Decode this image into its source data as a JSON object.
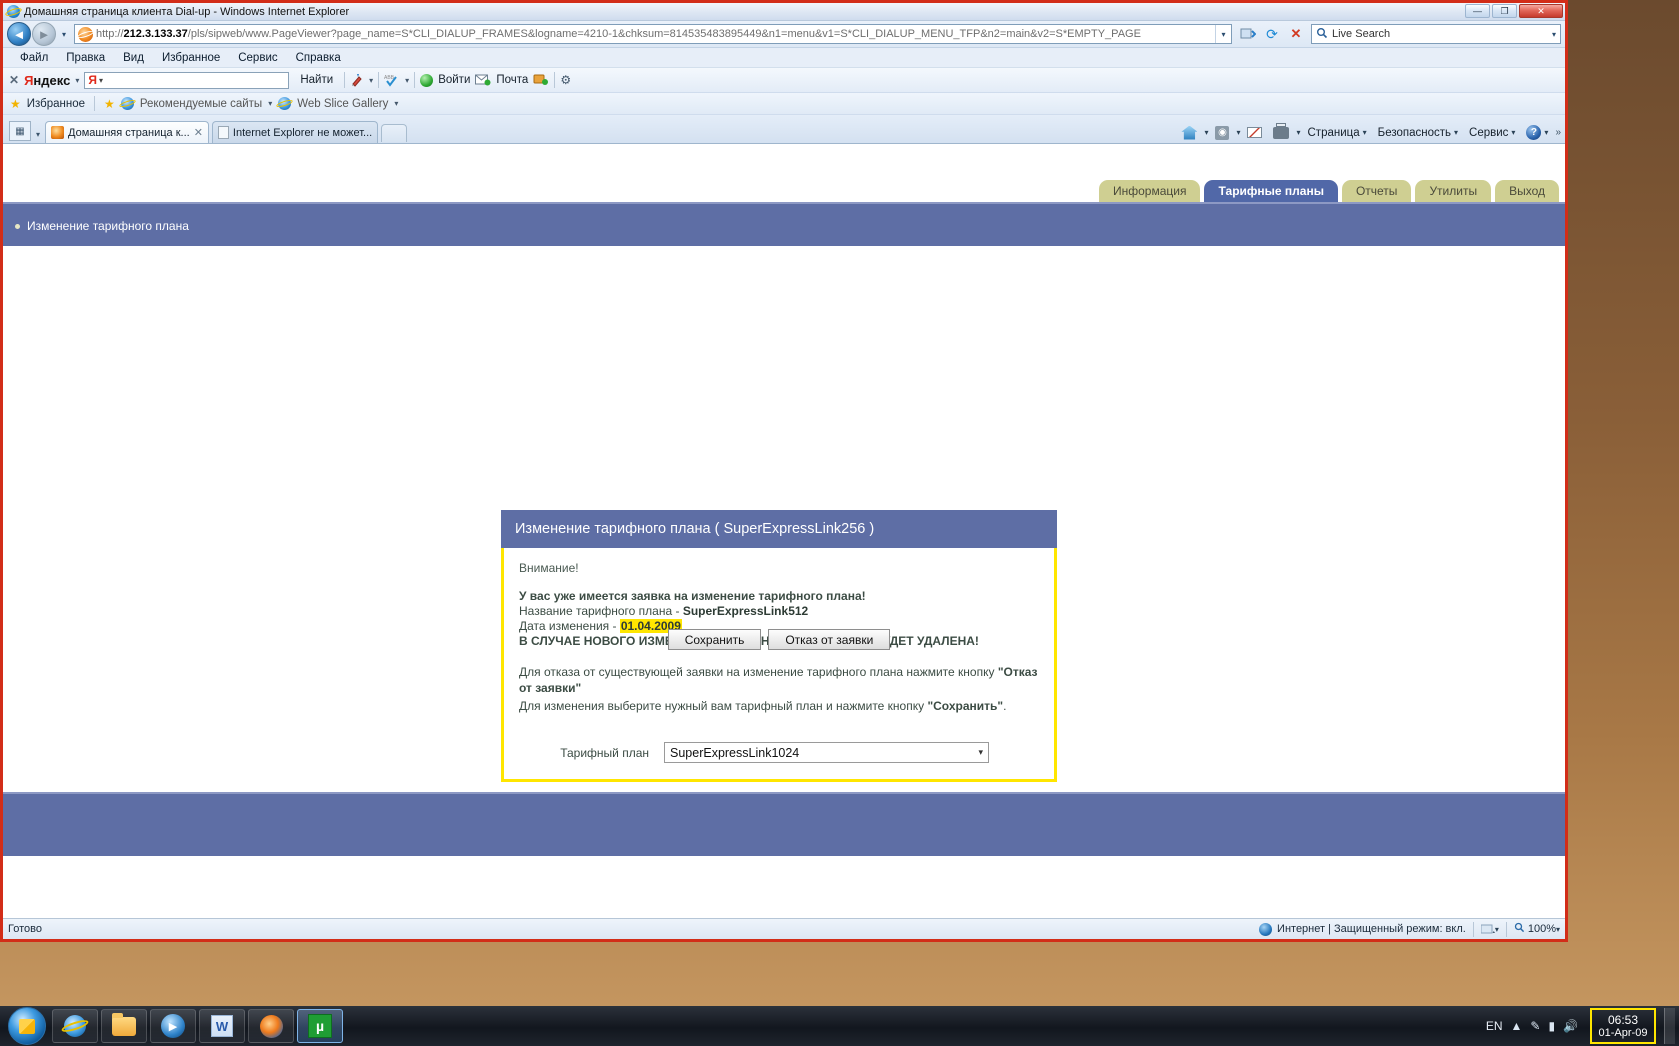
{
  "window": {
    "title": "Домашняя страница клиента Dial-up - Windows Internet Explorer",
    "icon": "ie-logo-icon",
    "minimize": "—",
    "maximize": "❐",
    "close": "✕"
  },
  "address_bar": {
    "back_icon": "◄",
    "forward_icon": "►",
    "history_caret": "▾",
    "url_prefix": "http://",
    "url_host": "212.3.133.37",
    "url_path": "/pls/sipweb/www.PageViewer?page_name=S*CLI_DIALUP_FRAMES&logname=4210-1&chksum=814535483895449&n1=menu&v1=S*CLI_DIALUP_MENU_TFP&n2=main&v2=S*EMPTY_PAGE",
    "dropdown_caret": "▾",
    "refresh_icon": "⟳",
    "stop_icon": "✕",
    "search_placeholder": "Live Search",
    "search_icon": "🔍",
    "search_caret": "▾"
  },
  "menubar": {
    "items": [
      "Файл",
      "Правка",
      "Вид",
      "Избранное",
      "Сервис",
      "Справка"
    ]
  },
  "yandex_bar": {
    "close_icon": "✕",
    "logo_first": "Я",
    "logo_rest": "ндекс",
    "logo_caret": "▾",
    "input_prefix": "Я",
    "input_value": "",
    "find_label": "Найти",
    "translate_caret": "▾",
    "spell_caret": "▾",
    "login_label": "Войти",
    "mail_label": "Почта",
    "gear_icon": "⚙"
  },
  "favorites_bar": {
    "star_icon": "★",
    "favorites_label": "Избранное",
    "suggested_label": "Рекомендуемые сайты",
    "suggested_caret": "▾",
    "webslice_label": "Web Slice Gallery",
    "webslice_caret": "▾"
  },
  "browser_tabs": {
    "quicktabs_icon": "▦",
    "quicktabs_caret": "▾",
    "items": [
      {
        "label": "Домашняя страница к...",
        "close": "✕",
        "active": true
      },
      {
        "label": "Internet Explorer не может...",
        "close": "",
        "active": false
      }
    ]
  },
  "command_bar": {
    "home_caret": "▾",
    "feeds_caret": "▾",
    "print_caret": "▾",
    "page_label": "Страница",
    "security_label": "Безопасность",
    "service_label": "Сервис",
    "help_caret": "▾",
    "overflow_icon": "»"
  },
  "page": {
    "nav_tabs": [
      {
        "label": "Информация",
        "active": false
      },
      {
        "label": "Тарифные планы",
        "active": true
      },
      {
        "label": "Отчеты",
        "active": false
      },
      {
        "label": "Утилиты",
        "active": false
      },
      {
        "label": "Выход",
        "active": false
      }
    ],
    "breadcrumb": "Изменение тарифного плана",
    "card": {
      "header": "Изменение тарифного плана ( SuperExpressLink256 )",
      "attention": "Внимание!",
      "warning_title": "У вас уже имеется заявка на изменение тарифного плана!",
      "plan_name_label": "Название тарифного плана - ",
      "plan_name_value": "SuperExpressLink512",
      "change_date_label": "Дата изменения - ",
      "change_date_value": "01.04.2009",
      "delete_notice": "В СЛУЧАЕ НОВОГО ИЗМЕНЕНИЯ ТАРИФНОГО ПЛАНА ОНА БУДЕТ УДАЛЕНА!",
      "instruction_1_a": "Для отказа от существующей заявки на изменение тарифного плана нажмите кнопку ",
      "instruction_1_b": "\"Отказ от заявки\"",
      "instruction_2_a": "Для изменения выберите нужный вам тарифный план и нажмите кнопку ",
      "instruction_2_b": "\"Сохранить\"",
      "instruction_2_c": ".",
      "select_label": "Тарифный план",
      "select_value": "SuperExpressLink1024",
      "select_caret": "▾",
      "save_button": "Сохранить",
      "cancel_button": "Отказ от заявки"
    },
    "colors": {
      "band": "#5e6ea5",
      "tab_inactive": "#cfcf92",
      "tab_active": "#5168a8",
      "highlight": "#ffe600"
    }
  },
  "status_bar": {
    "status": "Готово",
    "zone": "Интернет | Защищенный режим: вкл.",
    "zone_caret": "▾",
    "zoom": "100%",
    "zoom_caret": "▾",
    "zoom_icon": "🔍"
  },
  "taskbar": {
    "start_label": "",
    "apps": [
      {
        "name": "internet-explorer",
        "active": false
      },
      {
        "name": "file-explorer",
        "active": false
      },
      {
        "name": "media-player",
        "active": false
      },
      {
        "name": "word-document",
        "active": false
      },
      {
        "name": "firefox-browser",
        "active": false
      },
      {
        "name": "utorrent",
        "active": true
      }
    ],
    "tray": {
      "language": "EN",
      "show_hidden": "▲",
      "pen_icon": "✎",
      "network_icon": "▮",
      "volume_icon": "🔊",
      "time": "06:53",
      "date": "01-Apr-09"
    }
  }
}
